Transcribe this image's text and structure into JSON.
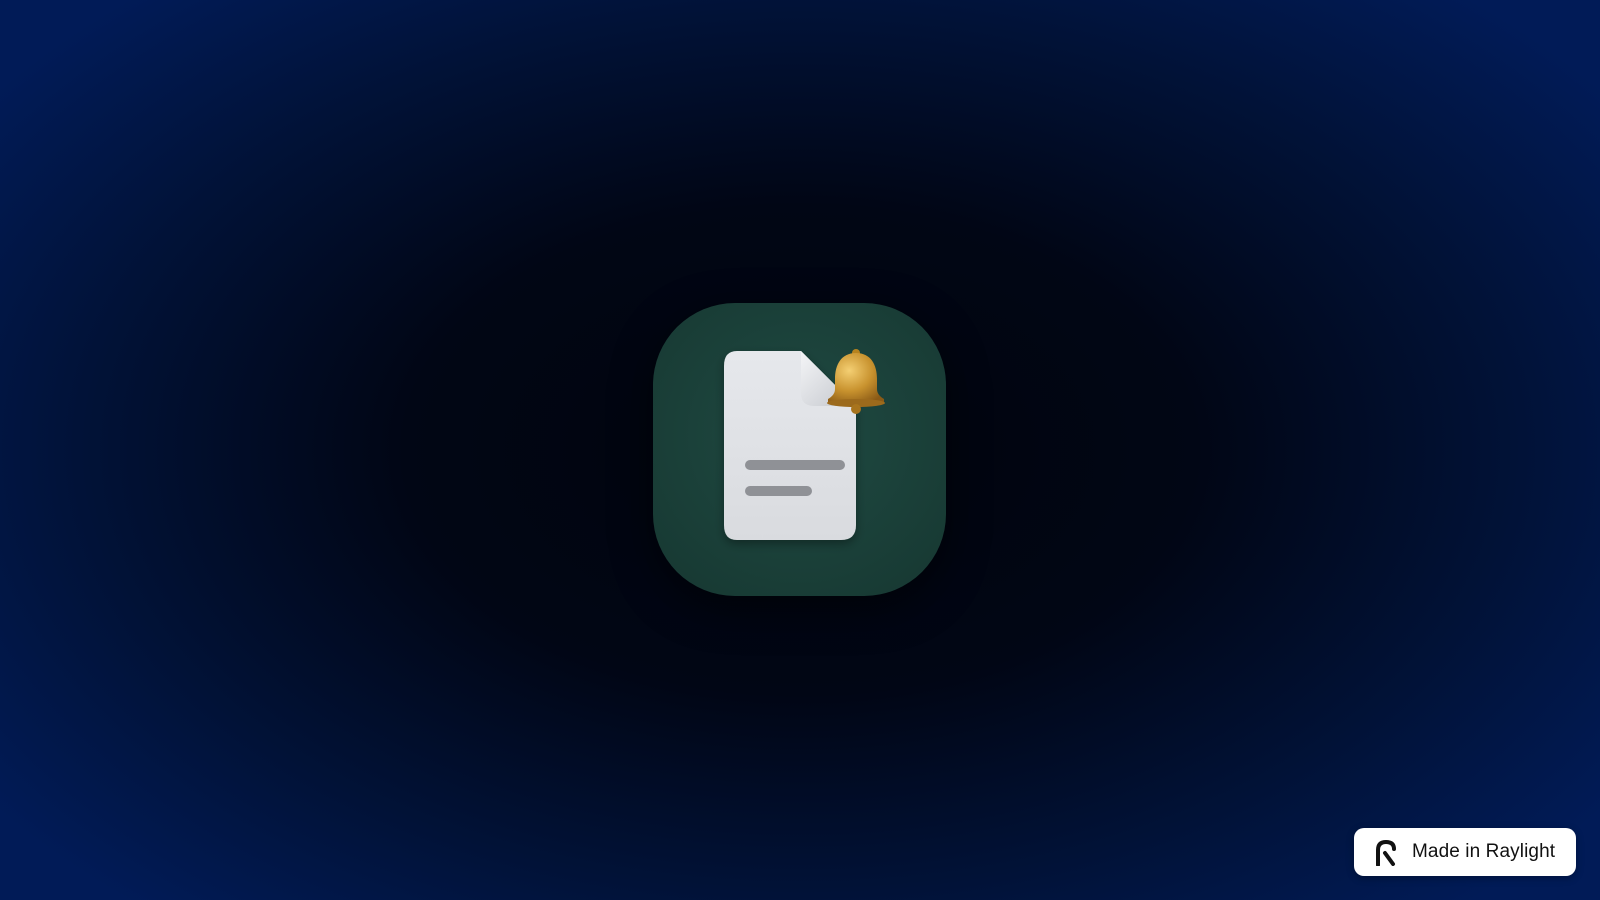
{
  "app_icon": {
    "icon": "document-bell-icon",
    "background_color": "#1a3f38"
  },
  "badge": {
    "label": "Made in Raylight",
    "logo_icon": "raylight-logo-icon"
  },
  "colors": {
    "background_edge": "#011b57",
    "background_center": "#01040c",
    "bell": "#c8922e",
    "document": "#e1e3e7"
  }
}
